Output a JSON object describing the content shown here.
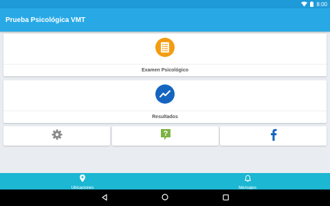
{
  "status_bar": {
    "time": "8:00",
    "icons": [
      "wifi-icon",
      "battery-icon"
    ]
  },
  "app_bar": {
    "title": "Prueba Psicológica VMT"
  },
  "cards": [
    {
      "label": "Examen Psicológico",
      "icon": "document-list-icon",
      "icon_color": "#f39c12"
    },
    {
      "label": "Resultados",
      "icon": "trending-chart-icon",
      "icon_color": "#1565c0"
    }
  ],
  "small_cards": [
    {
      "icon": "gear-icon",
      "color": "#8a8a8a"
    },
    {
      "icon": "help-question-icon",
      "color": "#7cb342"
    },
    {
      "icon": "facebook-icon",
      "color": "#1565c0"
    }
  ],
  "bottom_nav": [
    {
      "label": "Ubicaciones",
      "icon": "location-pin-icon"
    },
    {
      "label": "Mensajes",
      "icon": "bell-icon"
    }
  ],
  "colors": {
    "status_bar": "#1e9ad8",
    "app_bar": "#28a9e6",
    "bottom_nav": "#1bb7d3",
    "background": "#e9edf1"
  }
}
